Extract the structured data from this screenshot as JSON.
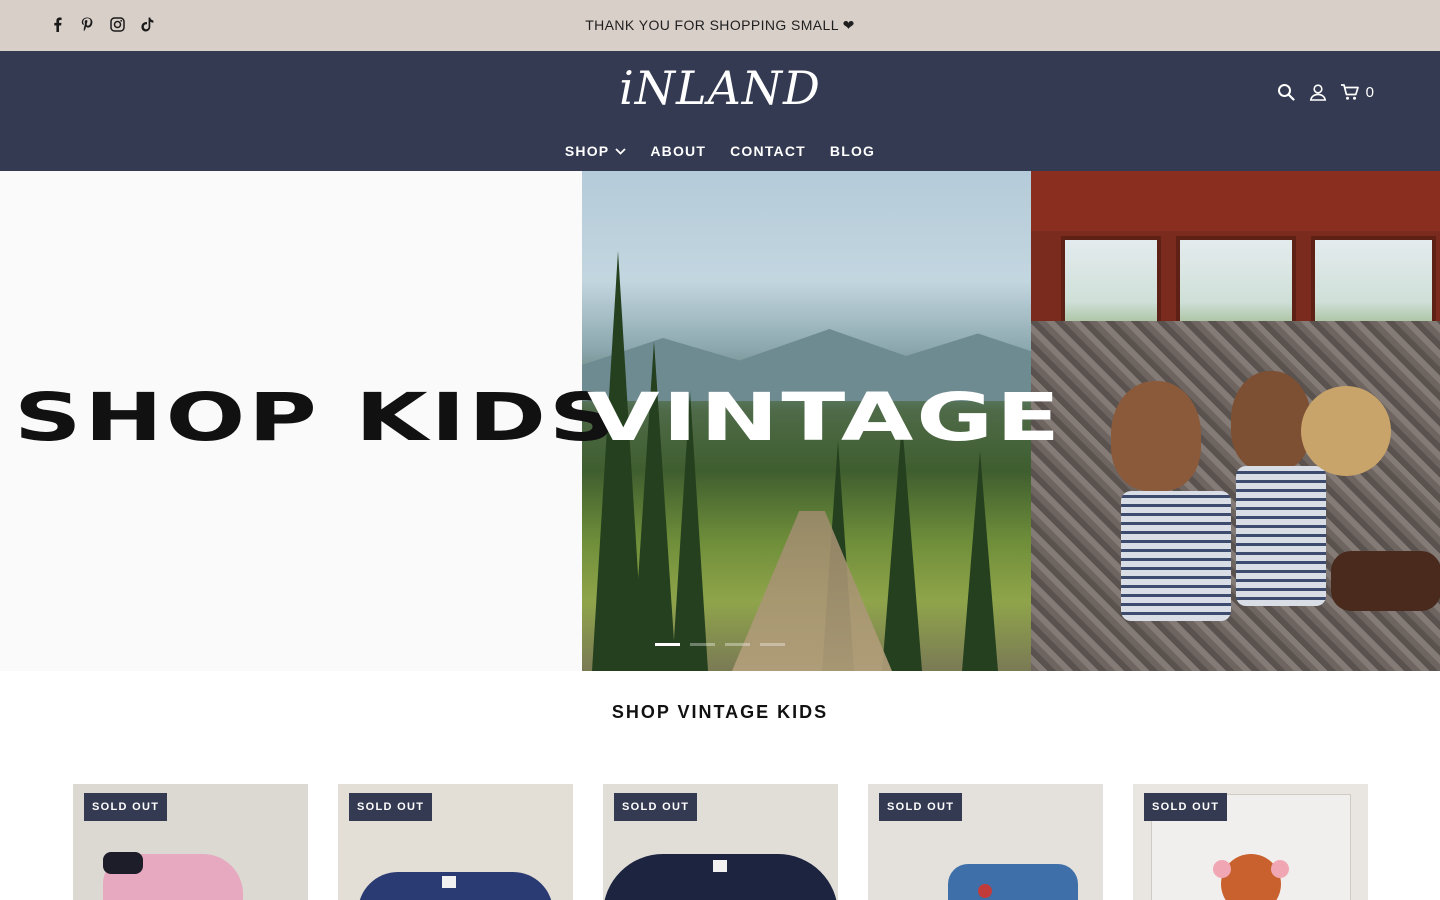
{
  "announcement": {
    "text": "THANK YOU FOR SHOPPING SMALL ❤",
    "social": [
      "facebook-icon",
      "pinterest-icon",
      "instagram-icon",
      "tiktok-icon"
    ]
  },
  "header": {
    "logo": "iNLAND",
    "cart_count": "0",
    "icons": [
      "search-icon",
      "account-icon",
      "cart-icon"
    ],
    "nav": [
      {
        "label": "SHOP",
        "has_dropdown": true
      },
      {
        "label": "ABOUT"
      },
      {
        "label": "CONTACT"
      },
      {
        "label": "BLOG"
      }
    ]
  },
  "hero": {
    "headline_left": "SHOP KIDS",
    "headline_right": "VINTAGE",
    "slide_count": 4,
    "active_slide": 1
  },
  "section": {
    "title": "SHOP VINTAGE KIDS"
  },
  "products": [
    {
      "badge": "SOLD OUT",
      "thumb": "pink-boots"
    },
    {
      "badge": "SOLD OUT",
      "thumb": "navy-tee"
    },
    {
      "badge": "SOLD OUT",
      "thumb": "navy-tee-dark"
    },
    {
      "badge": "SOLD OUT",
      "thumb": "denim-jacket"
    },
    {
      "badge": "SOLD OUT",
      "thumb": "deer-toy"
    }
  ],
  "colors": {
    "announcement_bg": "#d8cfc9",
    "header_bg": "#333a51",
    "badge_bg": "#333a51"
  }
}
